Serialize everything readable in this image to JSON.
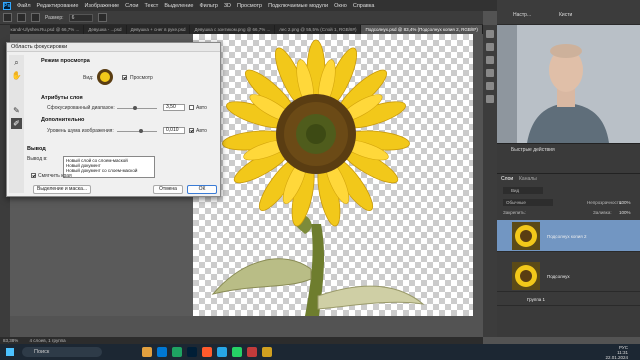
{
  "menu": [
    "Файл",
    "Редактирование",
    "Изображение",
    "Слои",
    "Текст",
    "Выделение",
    "Фильтр",
    "3D",
    "Просмотр",
    "Подключаемые модули",
    "Окно",
    "Справка"
  ],
  "options": {
    "select_label": "Выбрать:",
    "mode_label": "Размер:",
    "mode_value": "6"
  },
  "tabs": [
    {
      "label": "Alexandr-Ulyshev.Ru.psd @ 66,7% ...",
      "active": false
    },
    {
      "label": "Девушка - ...psd",
      "active": false
    },
    {
      "label": "Девушка + снег в руке.psd",
      "active": false
    },
    {
      "label": "Девушка с зонтиком.png @ 66,7% ...",
      "active": false
    },
    {
      "label": "лес 2.png @ 55,5% (Слой 1, RGB/8#)",
      "active": false
    },
    {
      "label": "Подсолнух.psd @ 83,4% (Подсолнух копия 2, RGB/8*)",
      "active": true
    },
    {
      "label": "Девушка ...",
      "active": false
    }
  ],
  "dialog": {
    "title": "Область фокусировки",
    "view_section": "Режим просмотра",
    "view_label": "Вид:",
    "preview_label": "Просмотр",
    "layer_attrs": "Атрибуты слоя",
    "focus_range_label": "Сфокусированный диапазон:",
    "focus_range_value": "3,50",
    "auto1": "Авто",
    "advanced": "Дополнительно",
    "noise_label": "Уровень шума изображения:",
    "noise_value": "0,010",
    "auto2": "Авто",
    "output_section": "Вывод",
    "output_label": "Вывод в:",
    "output_options": [
      "Новый слой со слоем-маской",
      "Новый документ",
      "Новый документ со слоем-маской"
    ],
    "soften_label": "Смягчить края",
    "select_mask_btn": "Выделение и маска...",
    "cancel_btn": "Отмена",
    "ok_btn": "ОК"
  },
  "status": {
    "zoom": "83,38%",
    "info": "4 слоев, 1 группа"
  },
  "taskbar": {
    "search": "Поиск",
    "lang": "РУС",
    "time": "11:31",
    "date": "22.01.2024"
  },
  "right_top": {
    "item1": "Настр...",
    "item2": "Кисти"
  },
  "quick_actions": "Быстрые действия",
  "layers": {
    "tabs": [
      "Слои",
      "Каналы"
    ],
    "kind": "Вид",
    "blend": "Обычные",
    "opacity_label": "Непрозрачность:",
    "opacity_value": "100%",
    "lock_label": "Закрепить:",
    "fill_label": "Заливка:",
    "fill_value": "100%",
    "items": [
      {
        "name": "Подсолнух копия 2",
        "selected": true
      },
      {
        "name": "Подсолнух",
        "selected": false
      },
      {
        "name": "Группа 1",
        "selected": false
      }
    ]
  },
  "colors": {
    "accent": "#31a8ff",
    "selected_layer": "#7296c2",
    "panel": "#3c3c3c"
  }
}
